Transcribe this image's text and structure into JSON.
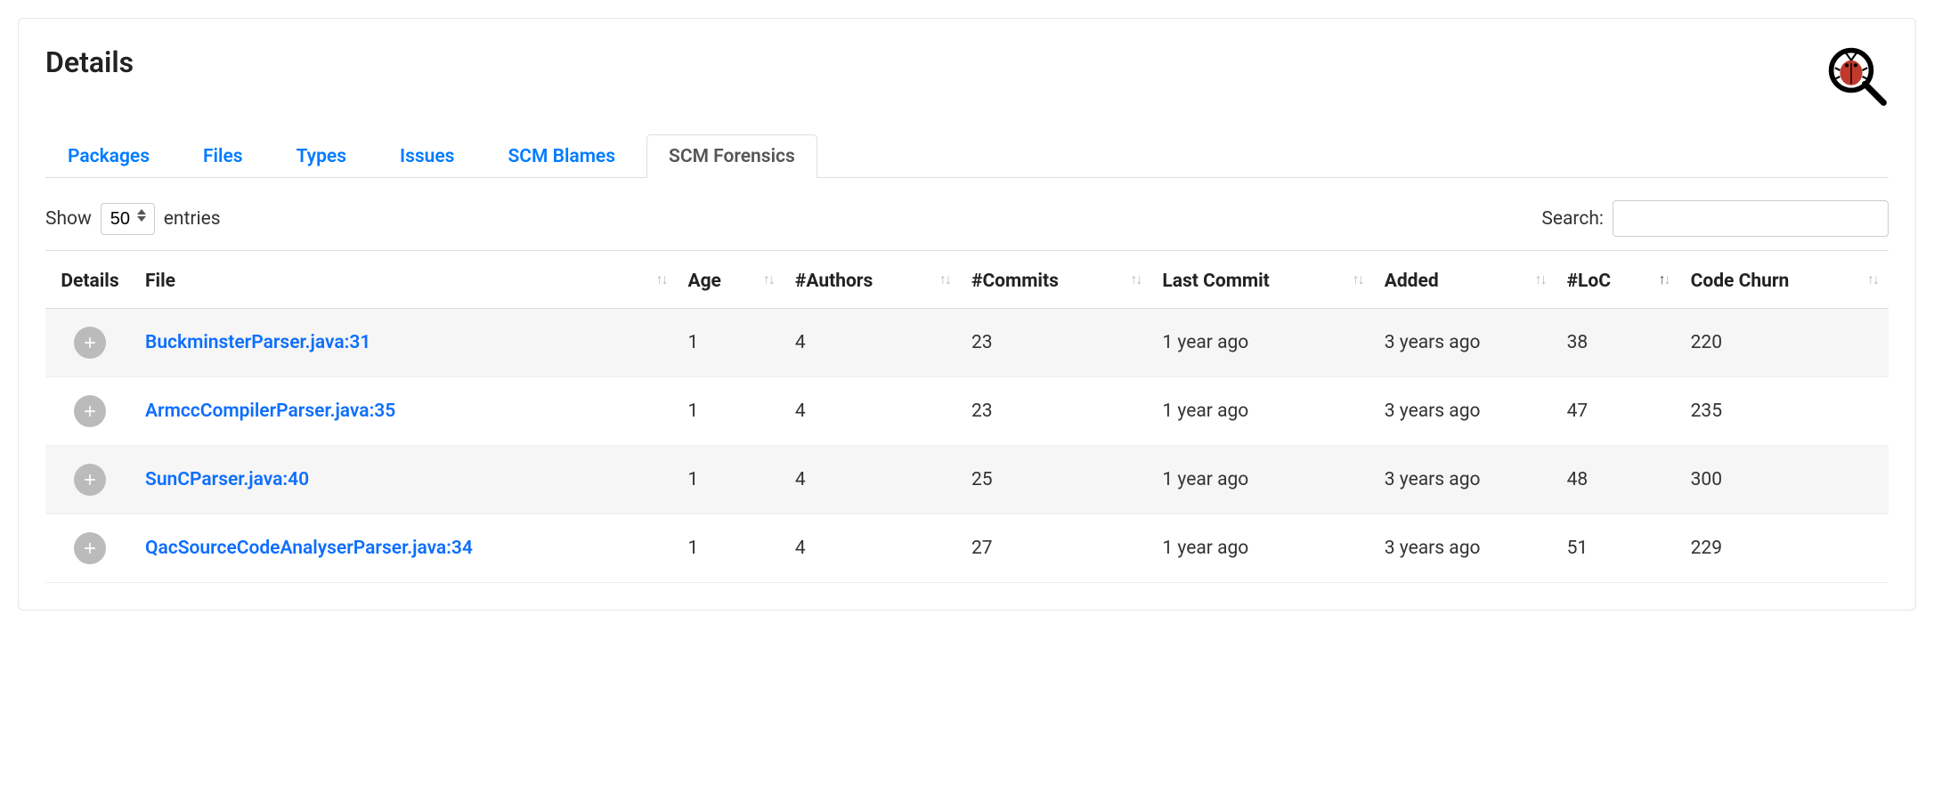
{
  "header": {
    "title": "Details"
  },
  "tabs": [
    {
      "label": "Packages",
      "active": false
    },
    {
      "label": "Files",
      "active": false
    },
    {
      "label": "Types",
      "active": false
    },
    {
      "label": "Issues",
      "active": false
    },
    {
      "label": "SCM Blames",
      "active": false
    },
    {
      "label": "SCM Forensics",
      "active": true
    }
  ],
  "controls": {
    "show_label_prefix": "Show",
    "show_label_suffix": "entries",
    "page_size": "50",
    "search_label": "Search:"
  },
  "columns": [
    {
      "label": "Details",
      "sortable": false
    },
    {
      "label": "File",
      "sortable": true
    },
    {
      "label": "Age",
      "sortable": true
    },
    {
      "label": "#Authors",
      "sortable": true
    },
    {
      "label": "#Commits",
      "sortable": true
    },
    {
      "label": "Last Commit",
      "sortable": true
    },
    {
      "label": "Added",
      "sortable": true
    },
    {
      "label": "#LoC",
      "sortable": true,
      "sorted": "asc"
    },
    {
      "label": "Code Churn",
      "sortable": true
    }
  ],
  "rows": [
    {
      "file": "BuckminsterParser.java:31",
      "age": "1",
      "authors": "4",
      "commits": "23",
      "last_commit": "1 year ago",
      "added": "3 years ago",
      "loc": "38",
      "churn": "220"
    },
    {
      "file": "ArmccCompilerParser.java:35",
      "age": "1",
      "authors": "4",
      "commits": "23",
      "last_commit": "1 year ago",
      "added": "3 years ago",
      "loc": "47",
      "churn": "235"
    },
    {
      "file": "SunCParser.java:40",
      "age": "1",
      "authors": "4",
      "commits": "25",
      "last_commit": "1 year ago",
      "added": "3 years ago",
      "loc": "48",
      "churn": "300"
    },
    {
      "file": "QacSourceCodeAnalyserParser.java:34",
      "age": "1",
      "authors": "4",
      "commits": "27",
      "last_commit": "1 year ago",
      "added": "3 years ago",
      "loc": "51",
      "churn": "229"
    }
  ]
}
